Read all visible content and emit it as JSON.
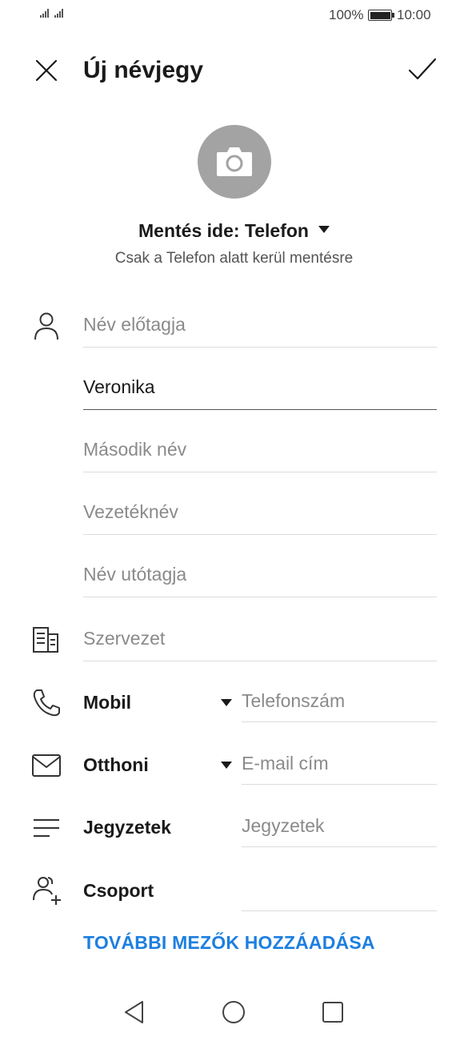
{
  "status_bar": {
    "battery_percent": "100%",
    "time": "10:00"
  },
  "header": {
    "title": "Új névjegy",
    "close_icon": "close-icon",
    "confirm_icon": "check-icon"
  },
  "photo": {
    "icon": "camera-icon",
    "background": "#a3a3a3"
  },
  "account": {
    "save_label": "Mentés ide: Telefon",
    "save_sub": "Csak a Telefon alatt kerül mentésre"
  },
  "name_fields": {
    "prefix_placeholder": "Név előtagja",
    "first_name_value": "Veronika",
    "middle_placeholder": "Második név",
    "last_placeholder": "Vezetéknév",
    "suffix_placeholder": "Név utótagja"
  },
  "organization": {
    "placeholder": "Szervezet"
  },
  "phone": {
    "type_label": "Mobil",
    "placeholder": "Telefonszám"
  },
  "email": {
    "type_label": "Otthoni",
    "placeholder": "E-mail cím"
  },
  "notes": {
    "label": "Jegyzetek",
    "placeholder": "Jegyzetek"
  },
  "group": {
    "label": "Csoport"
  },
  "add_more": {
    "label": "TOVÁBBI MEZŐK HOZZÁADÁSA",
    "color": "#1d7fe0"
  }
}
